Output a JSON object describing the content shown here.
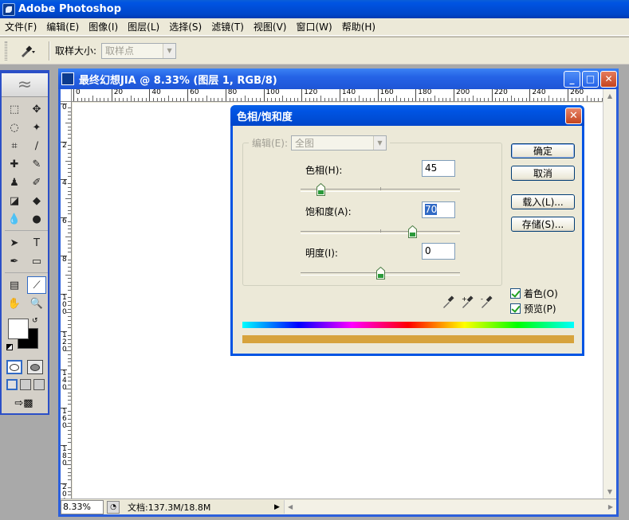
{
  "app": {
    "title": "Adobe Photoshop"
  },
  "menu": [
    "文件(F)",
    "编辑(E)",
    "图像(I)",
    "图层(L)",
    "选择(S)",
    "滤镜(T)",
    "视图(V)",
    "窗口(W)",
    "帮助(H)"
  ],
  "options": {
    "sample_size_label": "取样大小:",
    "sample_size_value": "取样点"
  },
  "document": {
    "title": "最终幻想JIA @ 8.33% (图层 1, RGB/8)",
    "hruler_labels": [
      "0",
      "20",
      "40",
      "60",
      "80",
      "100",
      "120",
      "140",
      "160",
      "180",
      "200",
      "220",
      "240",
      "260"
    ],
    "vruler_labels": [
      "0",
      "2",
      "4",
      "6",
      "8",
      "100",
      "120",
      "140",
      "160",
      "180",
      "200"
    ],
    "zoom": "8.33%",
    "doc_info": "文档:137.3M/18.8M"
  },
  "dialog": {
    "title": "色相/饱和度",
    "edit_label": "编辑(E):",
    "edit_value": "全图",
    "hue_label": "色相(H):",
    "hue_value": "45",
    "hue_level": 0.125,
    "saturation_label": "饱和度(A):",
    "saturation_value": "70",
    "saturation_level": 0.7,
    "lightness_label": "明度(I):",
    "lightness_value": "0",
    "lightness_level": 0.5,
    "ok_label": "确定",
    "cancel_label": "取消",
    "load_label": "载入(L)...",
    "save_label": "存储(S)...",
    "colorize_label": "着色(O)",
    "colorize_checked": true,
    "preview_label": "预览(P)",
    "preview_checked": true,
    "result_color": "#d7a33c"
  }
}
